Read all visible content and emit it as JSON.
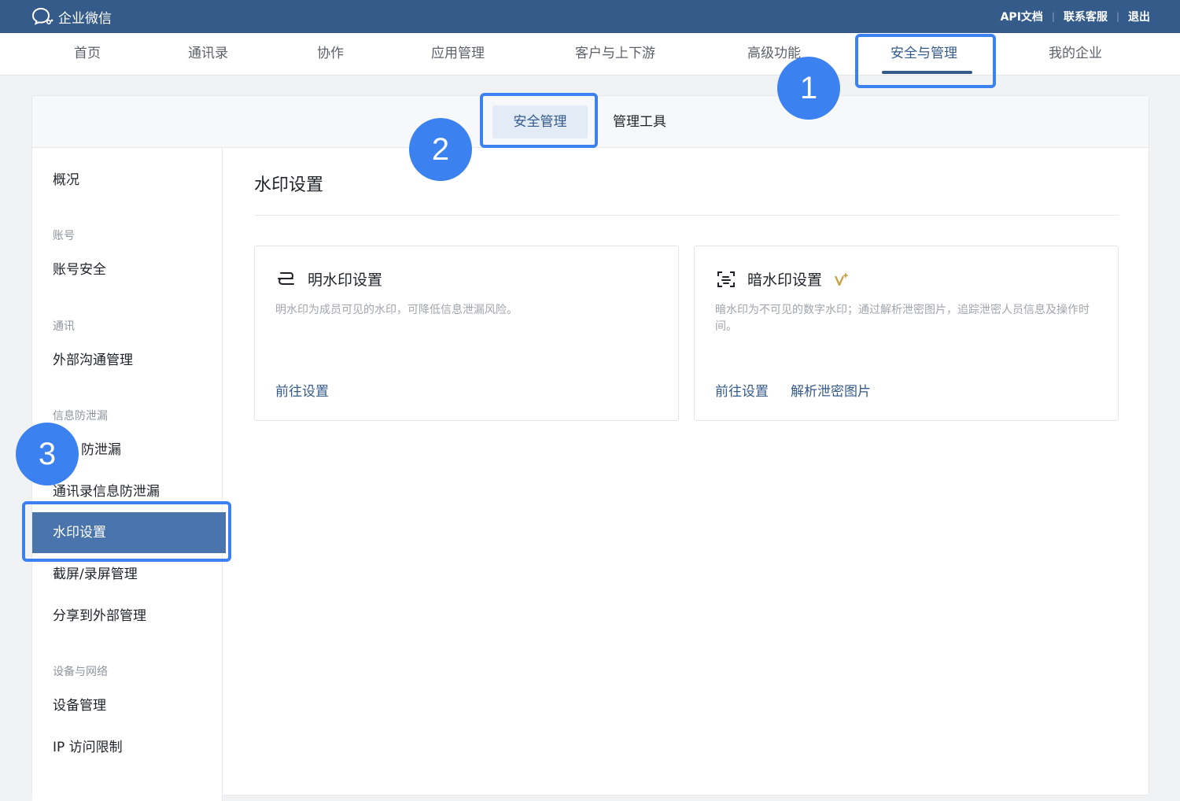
{
  "topbar": {
    "brand": "企业微信",
    "links": [
      "API文档",
      "联系客服",
      "退出"
    ]
  },
  "nav": {
    "items": [
      "首页",
      "通讯录",
      "协作",
      "应用管理",
      "客户与上下游",
      "高级功能",
      "安全与管理",
      "我的企业"
    ],
    "active": "安全与管理"
  },
  "subtabs": {
    "active": "安全管理",
    "other": "管理工具"
  },
  "sidebar": {
    "overview": "概况",
    "groups": {
      "account": "账号",
      "comm": "通讯",
      "leak": "信息防泄漏",
      "device": "设备与网络"
    },
    "items": {
      "account_security": "账号安全",
      "external_comm": "外部沟通管理",
      "leak_prevention": "防泄漏",
      "contacts_leak": "通讯录信息防泄漏",
      "watermark": "水印设置",
      "screenshot": "截屏/录屏管理",
      "share_external": "分享到外部管理",
      "device_mgmt": "设备管理",
      "ip_limit": "IP 访问限制"
    }
  },
  "content": {
    "title": "水印设置",
    "cards": [
      {
        "title": "明水印设置",
        "desc": "明水印为成员可见的水印，可降低信息泄漏风险。",
        "links": [
          "前往设置"
        ]
      },
      {
        "title": "暗水印设置",
        "desc": "暗水印为不可见的数字水印；通过解析泄密图片，追踪泄密人员信息及操作时间。",
        "links": [
          "前往设置",
          "解析泄密图片"
        ]
      }
    ]
  },
  "annotations": [
    "1",
    "2",
    "3"
  ],
  "colors": {
    "brand": "#355b8a",
    "active_sidebar": "#4a75ac",
    "highlight": "#3b82f0",
    "sparkle": "#c9a24a"
  }
}
